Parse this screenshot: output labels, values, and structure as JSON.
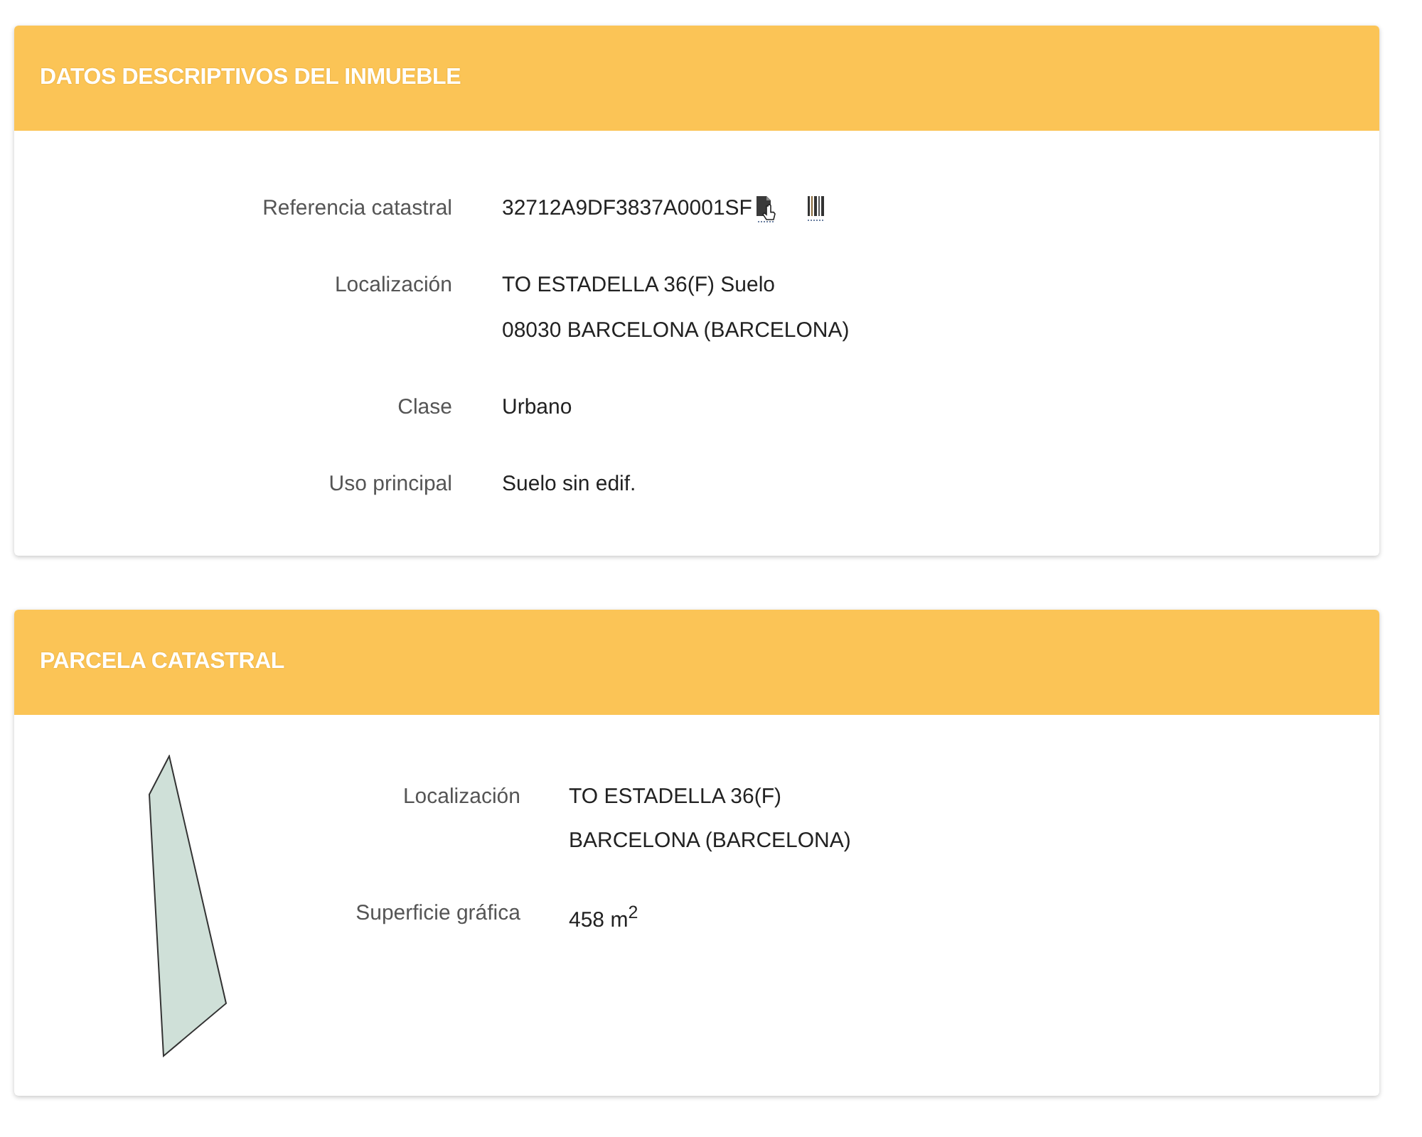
{
  "sections": [
    {
      "kind": "details",
      "title": "DATOS DESCRIPTIVOS DEL INMUEBLE",
      "fields": [
        {
          "kind": "reference",
          "label": "Referencia catastral",
          "lines": [
            "32712A9DF3837A0001SF"
          ]
        },
        {
          "kind": "text",
          "label": "Localización",
          "lines": [
            "TO ESTADELLA 36(F) Suelo",
            "08030 BARCELONA (BARCELONA)"
          ]
        },
        {
          "kind": "text",
          "label": "Clase",
          "lines": [
            "Urbano"
          ]
        },
        {
          "kind": "text",
          "label": "Uso principal",
          "lines": [
            "Suelo sin edif."
          ]
        }
      ]
    },
    {
      "kind": "parcel",
      "title": "PARCELA CATASTRAL",
      "fields": [
        {
          "kind": "text",
          "label": "Localización",
          "lines": [
            "TO ESTADELLA 36(F)",
            "BARCELONA (BARCELONA)"
          ]
        },
        {
          "kind": "text",
          "label": "Superficie gráfica",
          "lines": [
            "458 m$^{2}$"
          ]
        }
      ]
    }
  ]
}
